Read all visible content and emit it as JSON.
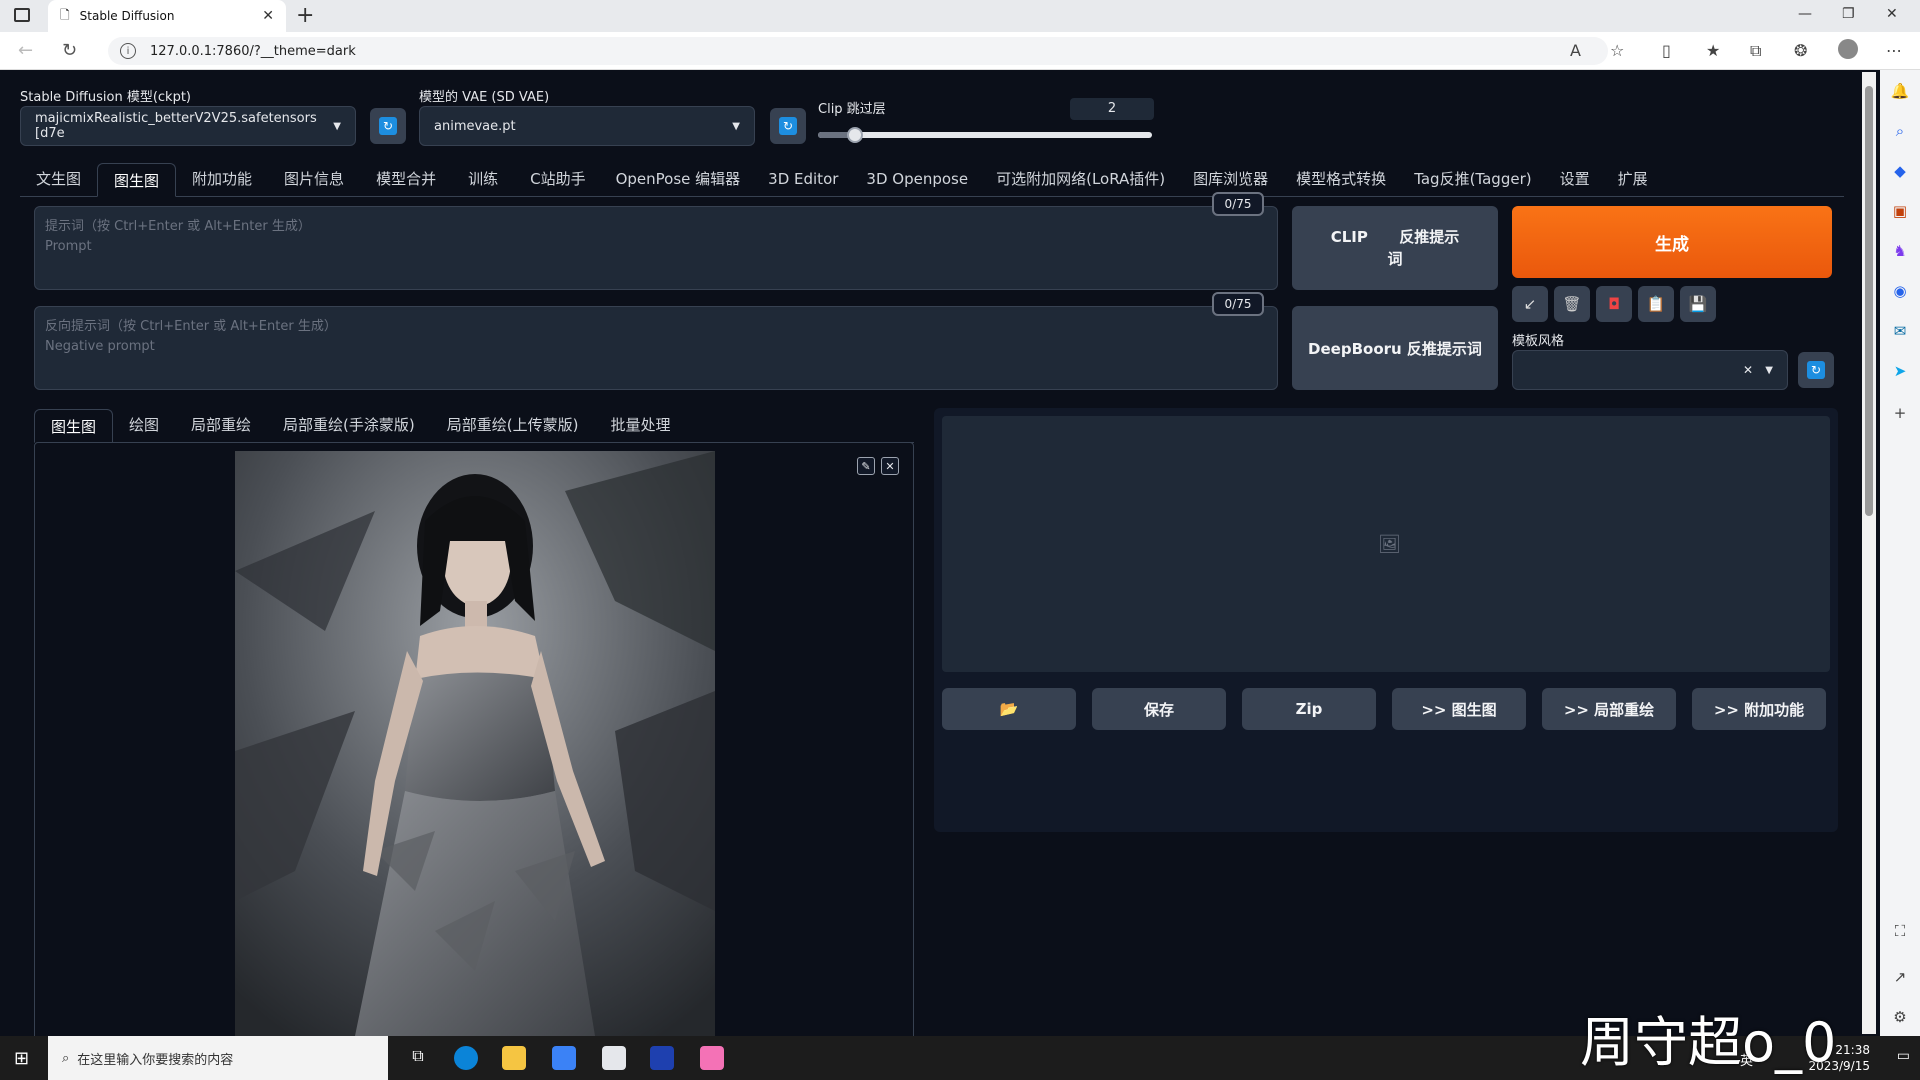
{
  "browser": {
    "tab_title": "Stable Diffusion",
    "url": "127.0.0.1:7860/?__theme=dark"
  },
  "top": {
    "ckpt_label": "Stable Diffusion 模型(ckpt)",
    "ckpt_value": "majicmixRealistic_betterV2V25.safetensors [d7e",
    "vae_label": "模型的 VAE (SD VAE)",
    "vae_value": "animevae.pt",
    "clip_label": "Clip 跳过层",
    "clip_value": "2",
    "clip_fraction": 0.11
  },
  "main_tabs": [
    "文生图",
    "图生图",
    "附加功能",
    "图片信息",
    "模型合并",
    "训练",
    "C站助手",
    "OpenPose 编辑器",
    "3D Editor",
    "3D Openpose",
    "可选附加网络(LoRA插件)",
    "图库浏览器",
    "模型格式转换",
    "Tag反推(Tagger)",
    "设置",
    "扩展"
  ],
  "prompt": {
    "placeholder_line1": "提示词（按 Ctrl+Enter 或 Alt+Enter 生成）",
    "placeholder_line2": "Prompt",
    "counter": "0/75"
  },
  "negative": {
    "placeholder_line1": "反向提示词（按 Ctrl+Enter 或 Alt+Enter 生成）",
    "placeholder_line2": "Negative prompt",
    "counter": "0/75"
  },
  "actions": {
    "clip_btn_part1": "CLIP",
    "clip_btn_part2": "反推提示",
    "clip_btn_part3": "词",
    "deepbooru_btn": "DeepBooru 反推提示词",
    "generate_btn": "生成",
    "style_label": "模板风格"
  },
  "sub_tabs": [
    "图生图",
    "绘图",
    "局部重绘",
    "局部重绘(手涂蒙版)",
    "局部重绘(上传蒙版)",
    "批量处理"
  ],
  "output_buttons": [
    "📂",
    "保存",
    "Zip",
    ">> 图生图",
    ">> 局部重绘",
    ">> 附加功能"
  ],
  "taskbar": {
    "search_placeholder": "在这里输入你要搜索的内容",
    "time": "21:38",
    "date": "2023/9/15",
    "ime": "英"
  },
  "watermark": "周守超o_0",
  "colors": {
    "accent": "#ea580c",
    "bg": "#0b0f19",
    "panel": "#1f2937",
    "refresh": "#1d8ee0"
  }
}
